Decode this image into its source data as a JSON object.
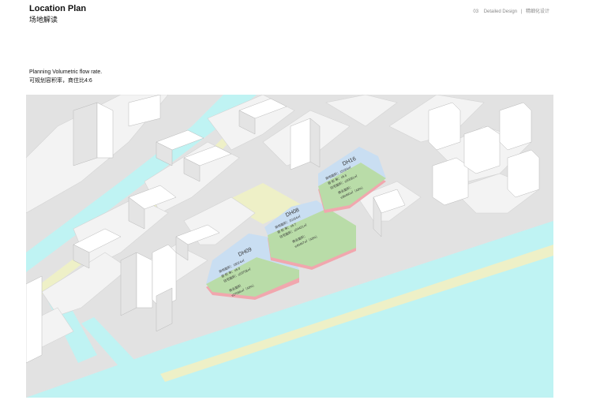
{
  "header": {
    "title": "Location Plan",
    "subtitle": "场地解读",
    "page_number": "03",
    "section_en": "Detailed Design",
    "separator": "|",
    "section_cn": "精细化设计"
  },
  "caption": {
    "english": "Planning Volumetric flow rate.",
    "chinese": "可规划容积率，商住比4:6"
  },
  "colors": {
    "water": "#bff3f3",
    "road": "#e2e2e2",
    "block": "#f3f3f3",
    "green": "#eef0c7",
    "parcel_blue": "#c9def2",
    "parcel_green": "#b9dca8",
    "parcel_red": "#f1a7ae"
  },
  "plots": [
    {
      "id": "DH09",
      "blue_lines": [
        "用地面积：18024㎡",
        "容 积 率：≤5.0",
        "住宅面积：≤53708㎡"
      ],
      "green_lines": [
        "商业面积",
        "≤27056㎡（43%）"
      ]
    },
    {
      "id": "DH08",
      "blue_lines": [
        "用地面积：20184㎡",
        "容 积 率：≤5.7",
        "住宅面积：≤54421㎡"
      ],
      "green_lines": [
        "商业面积：",
        "≤40467㎡（43%）"
      ]
    },
    {
      "id": "DH16",
      "blue_lines": [
        "用地面积：15184㎡",
        "容 积 率：≤5.5",
        "住宅面积：≤50081㎡"
      ],
      "green_lines": [
        "商业面积：",
        "≤36460㎡（43%）"
      ]
    }
  ]
}
